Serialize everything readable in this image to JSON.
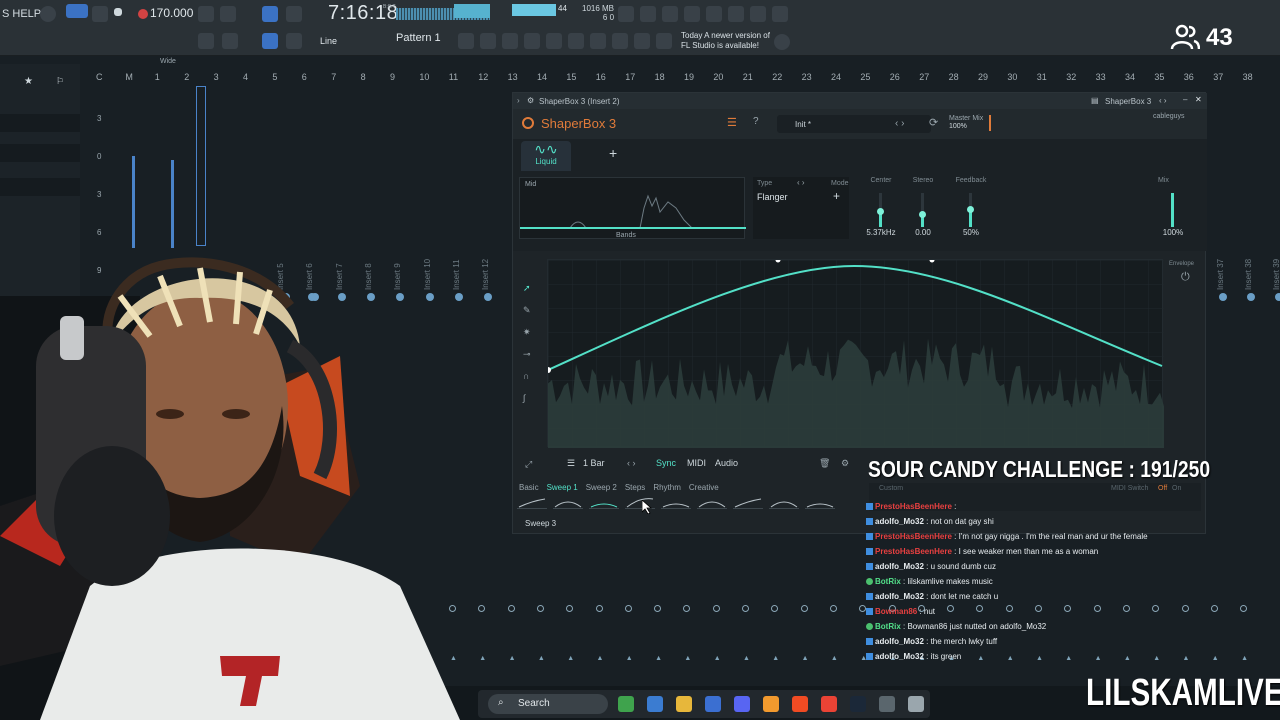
{
  "topbar": {
    "help": "S HELP",
    "bpm": "170.000",
    "clock": "7:16:18",
    "clock_sub": "B:S:T",
    "mem": "1016 MB",
    "mem_sub": "6 0",
    "cpu_val": "44",
    "pattern": "Pattern 1",
    "line_mode": "Line",
    "notice_line1": "Today  A newer version of",
    "notice_line2": "FL Studio is available!",
    "wide": "Wide"
  },
  "viewers": {
    "count": "43",
    "icon": "people-icon"
  },
  "ruler": [
    "C",
    "M",
    "1",
    "2",
    "3",
    "4",
    "5",
    "6",
    "7",
    "8",
    "9",
    "10",
    "11",
    "12",
    "13",
    "14",
    "15",
    "16",
    "17",
    "18",
    "19",
    "20",
    "21",
    "22",
    "23",
    "24",
    "25",
    "26",
    "27",
    "28",
    "29",
    "30",
    "31",
    "32",
    "33",
    "34",
    "35",
    "36",
    "37",
    "38"
  ],
  "left_levels": [
    "3",
    "0",
    "3",
    "6",
    "9"
  ],
  "inserts": [
    "Insert 5",
    "Insert 6",
    "Insert 7",
    "Insert 8",
    "Insert 9",
    "Insert 10",
    "Insert 11",
    "Insert 12",
    "Insert 37",
    "Insert 38",
    "Insert 39"
  ],
  "plugin": {
    "window_title": "ShaperBox 3 (Insert 2)",
    "window_title_right": "ShaperBox 3",
    "logo": "ShaperBox 3",
    "preset": "Init *",
    "master_mix_label": "Master Mix",
    "master_mix_value": "100%",
    "brand": "cableguys",
    "tab_liquid": "Liquid",
    "add_tab": "+",
    "mid_label": "Mid",
    "bands_label": "Bands",
    "type_label": "Type",
    "type_value": "Flanger",
    "mode_label": "Mode",
    "params": [
      {
        "label": "Center",
        "value": "5.37kHz",
        "fill": 0.45
      },
      {
        "label": "Stereo",
        "value": "0.00",
        "fill": 0.35
      },
      {
        "label": "Feedback",
        "value": "50%",
        "fill": 0.5
      }
    ],
    "mix_label": "Mix",
    "mix_value": "100%",
    "mix_fill": 1.0,
    "envelope_label": "Envelope",
    "length": "1 Bar",
    "sync": "Sync",
    "midi": "MIDI",
    "audio": "Audio",
    "shape_tabs": [
      "Basic",
      "Sweep 1",
      "Sweep 2",
      "Steps",
      "Rhythm",
      "Creative"
    ],
    "active_shape_tab": "Sweep 1",
    "current_shape": "Sweep 3",
    "right_custom": "Custom",
    "midi_switch": "MIDI Switch",
    "off": "Off",
    "on": "On"
  },
  "overlay": {
    "challenge": "SOUR CANDY CHALLENGE : 191/250",
    "brand": "LILSKAMLIVE"
  },
  "chat": [
    {
      "user": "PrestoHasBeenHere",
      "text": "",
      "user_color": "#e84040"
    },
    {
      "user": "adolfo_Mo32",
      "text": "not on dat gay shi",
      "user_color": "#e7ecef"
    },
    {
      "user": "PrestoHasBeenHere",
      "text": "I'm not gay nigga . I'm the real man and ur the female",
      "user_color": "#e84040"
    },
    {
      "user": "PrestoHasBeenHere",
      "text": "I see weaker men than me as a woman",
      "user_color": "#e84040"
    },
    {
      "user": "adolfo_Mo32",
      "text": "u sound dumb cuz",
      "user_color": "#e7ecef"
    },
    {
      "user": "BotRix",
      "text": "lilskamlive makes music",
      "user_color": "#53e08a"
    },
    {
      "user": "adolfo_Mo32",
      "text": "dont let me catch u",
      "user_color": "#e7ecef"
    },
    {
      "user": "Bowman86",
      "text": "nut",
      "user_color": "#e84040"
    },
    {
      "user": "BotRix",
      "text": "Bowman86 just nutted on adolfo_Mo32",
      "user_color": "#53e08a"
    },
    {
      "user": "adolfo_Mo32",
      "text": "the merch lwky tuff",
      "user_color": "#e7ecef"
    },
    {
      "user": "adolfo_Mo32",
      "text": "its green",
      "user_color": "#e7ecef"
    }
  ],
  "taskbar": {
    "search": "Search",
    "apps": [
      "widgets-icon",
      "copilot-icon",
      "explorer-icon",
      "store-icon",
      "discord-icon",
      "fl-studio-icon",
      "brave-icon",
      "chrome-icon",
      "steam-icon",
      "app-icon",
      "ableton-icon"
    ]
  },
  "colors": {
    "accent": "#53e0c7",
    "logo_orange": "#e07b3a",
    "fl_blue": "#3b72c4"
  }
}
